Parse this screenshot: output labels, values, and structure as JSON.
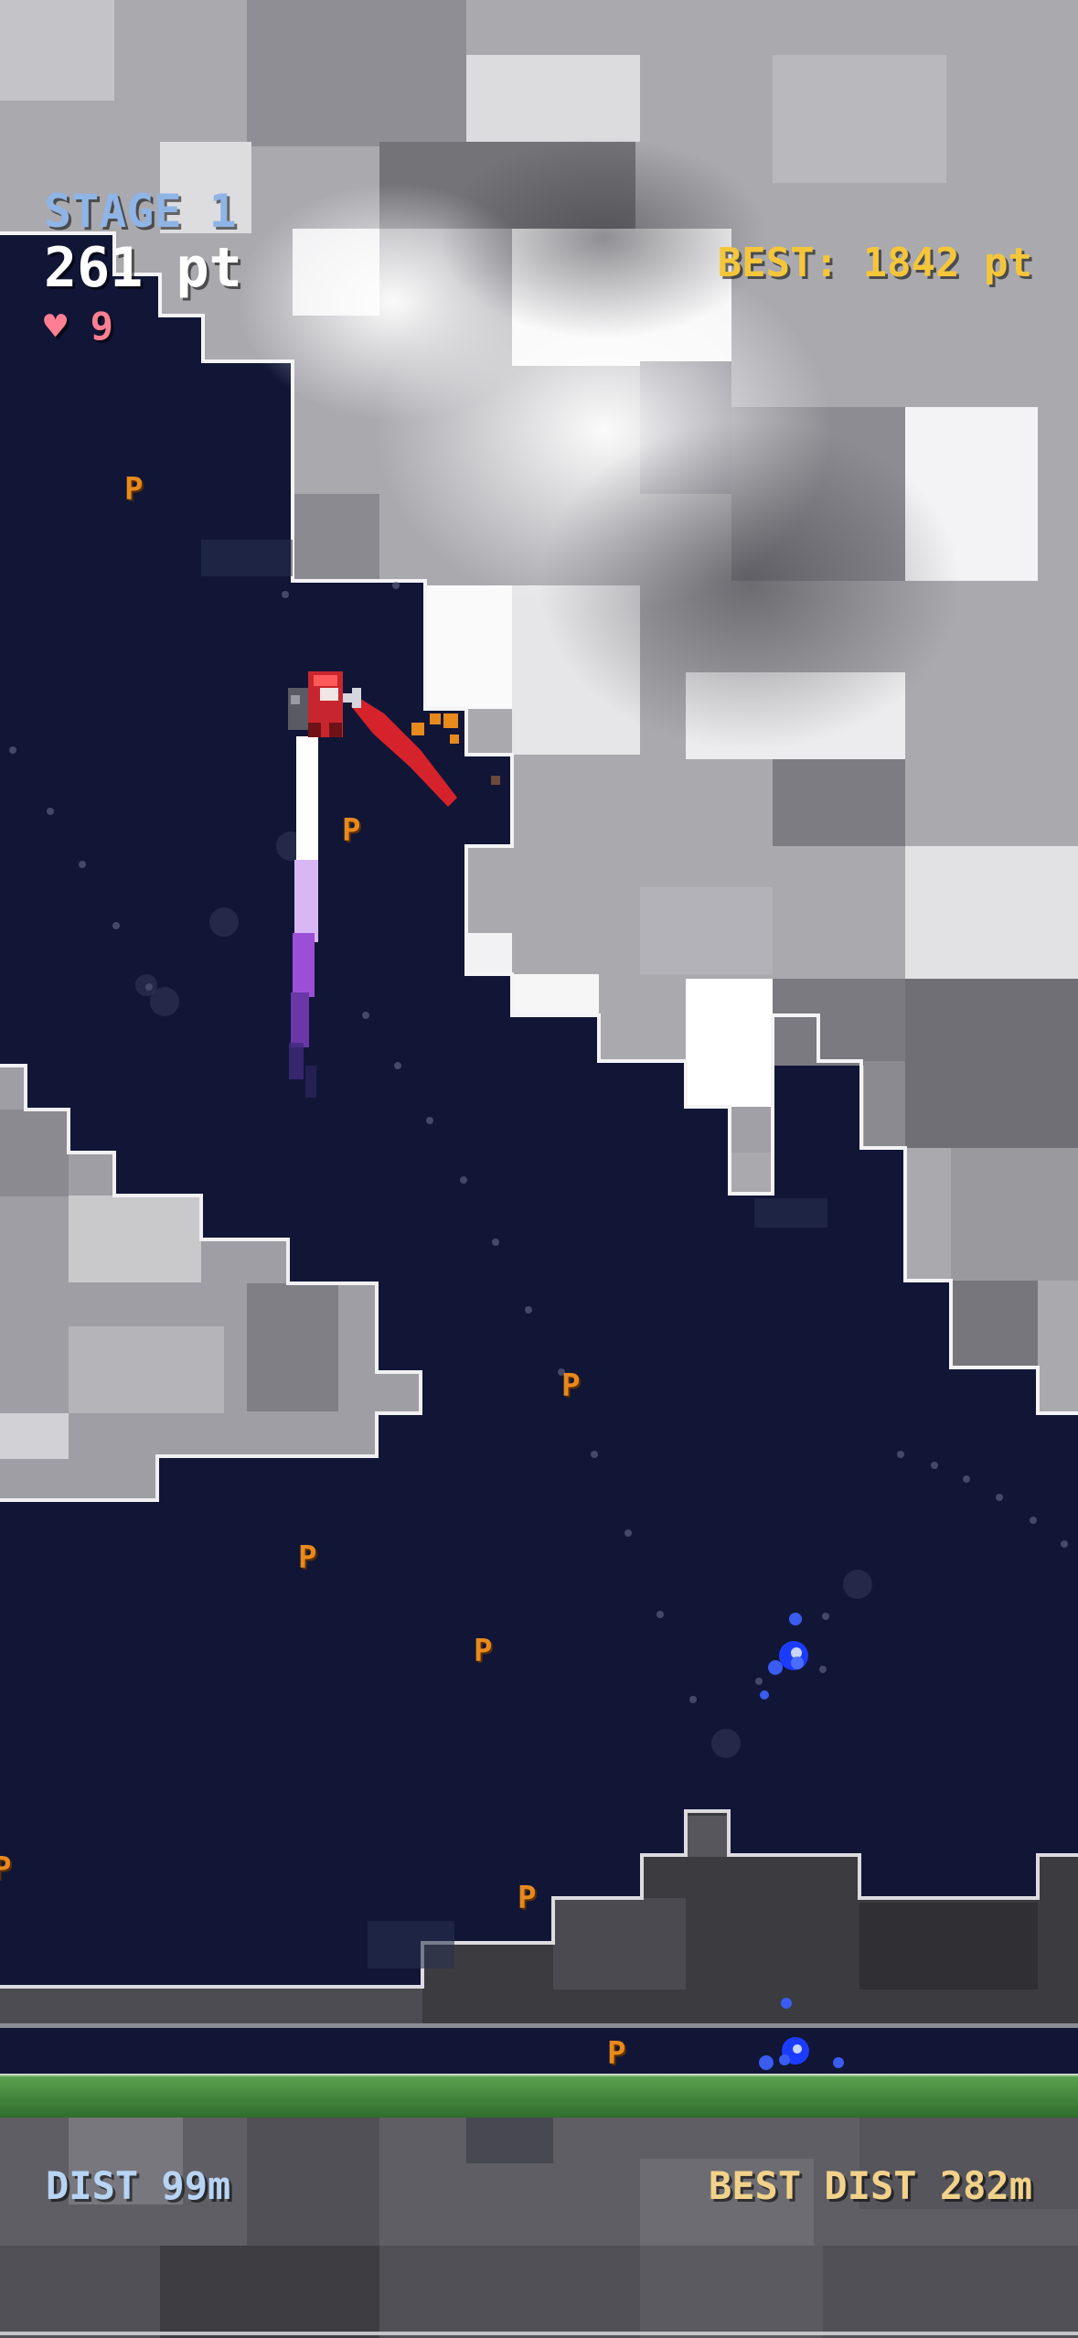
{
  "hud": {
    "stage": "STAGE 1",
    "score": "261 pt",
    "lives_icon": "heart-icon",
    "lives": "♥ 9",
    "best": "BEST: 1842 pt",
    "distance": "DIST 99m",
    "best_distance": "BEST DIST 282m"
  },
  "pickups": [
    {
      "label": "P"
    },
    {
      "label": "P"
    },
    {
      "label": "P"
    },
    {
      "label": "P"
    },
    {
      "label": "P"
    },
    {
      "label": "P"
    },
    {
      "label": "P"
    },
    {
      "label": "P"
    }
  ],
  "colors": {
    "sky": "#111637",
    "cloud_light": "#d6d6d9",
    "cloud_mid": "#9a9aa0",
    "cloud_dark": "#5a5a60",
    "ground_grass": "#3e8a3a",
    "player": "#c8262e",
    "scarf": "#d6232b",
    "trail": "#9b4fd6",
    "pickup": "#e8891d",
    "stage_text": "#8fb4e6",
    "best_text": "#f5c63a",
    "lives_text": "#ff7f92"
  }
}
